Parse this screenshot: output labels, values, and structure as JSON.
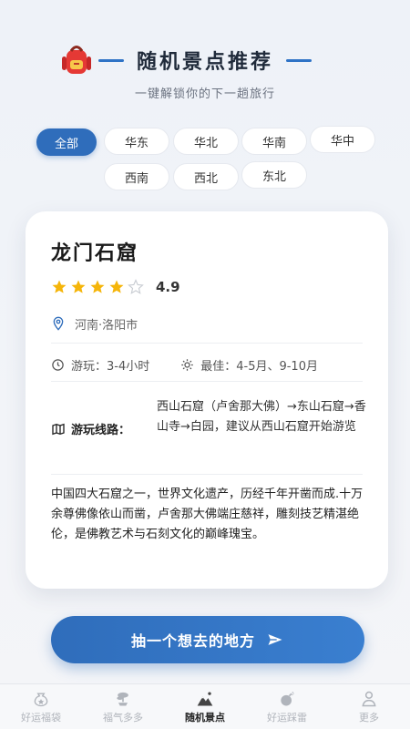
{
  "header": {
    "title": "随机景点推荐",
    "subtitle": "一键解锁你的下一趟旅行"
  },
  "regions": [
    "全部",
    "华东",
    "华北",
    "华南",
    "华中",
    "西南",
    "西北",
    "东北"
  ],
  "selected_region": "全部",
  "spot": {
    "name": "龙门石窟",
    "rating": "4.9",
    "stars_filled": 4,
    "stars_total": 5,
    "location": "河南·洛阳市",
    "duration": "游玩：3-4小时",
    "best_time": "最佳：4-5月、9-10月",
    "route_label": "游玩线路：",
    "route": "西山石窟（卢舍那大佛）→东山石窟→香山寺→白园，建议从西山石窟开始游览",
    "description": "中国四大石窟之一，世界文化遗产，历经千年开凿而成.十万余尊佛像依山而凿，卢舍那大佛端庄慈祥，雕刻技艺精湛绝伦，是佛教艺术与石刻文化的巅峰瑰宝。"
  },
  "cta": {
    "label": "抽一个想去的地方"
  },
  "tabs": [
    {
      "label": "好运福袋",
      "icon": "lucky-bag-icon"
    },
    {
      "label": "福气多多",
      "icon": "bonsai-icon"
    },
    {
      "label": "随机景点",
      "icon": "mountain-icon"
    },
    {
      "label": "好运踩雷",
      "icon": "bomb-icon"
    },
    {
      "label": "更多",
      "icon": "user-icon"
    }
  ],
  "active_tab": "随机景点",
  "colors": {
    "accent": "#2f6dbb",
    "star": "#f5b50a",
    "tab_inactive": "#b0b4bb"
  }
}
